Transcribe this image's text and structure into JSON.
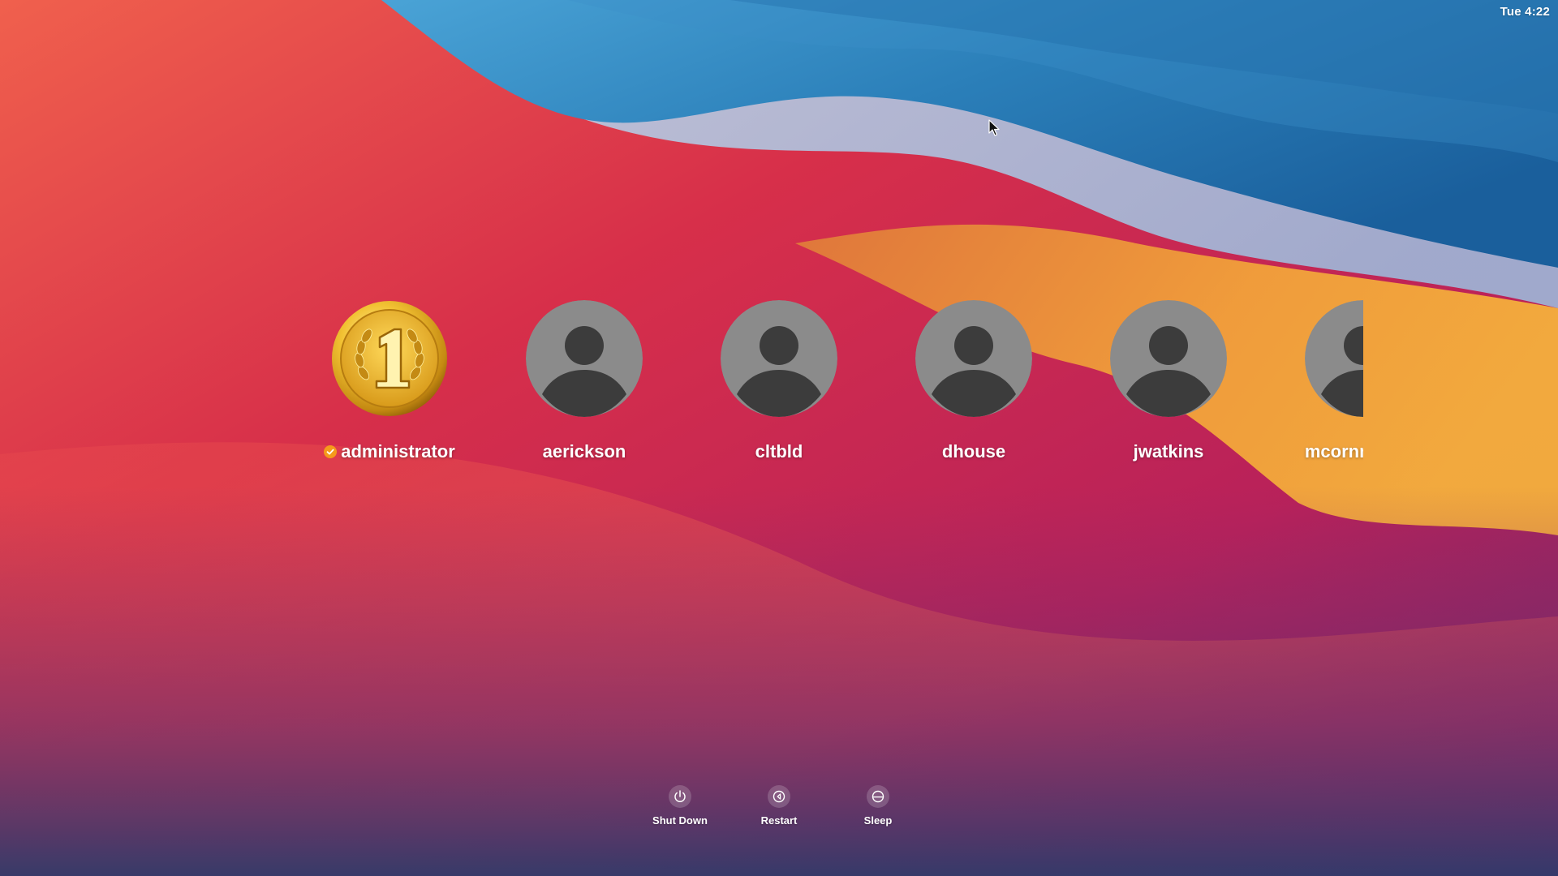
{
  "menubar": {
    "clock": "Tue 4:22"
  },
  "users": [
    {
      "name": "administrator",
      "avatar": "gold-medal-number-one",
      "badge": "checkmark-badge-icon"
    },
    {
      "name": "aerickson",
      "avatar": "generic-user-silhouette"
    },
    {
      "name": "cltbld",
      "avatar": "generic-user-silhouette"
    },
    {
      "name": "dhouse",
      "avatar": "generic-user-silhouette"
    },
    {
      "name": "jwatkins",
      "avatar": "generic-user-silhouette"
    },
    {
      "name": "mcornmesser",
      "avatar": "generic-user-silhouette"
    }
  ],
  "power": {
    "shutdown_label": "Shut Down",
    "restart_label": "Restart",
    "sleep_label": "Sleep"
  },
  "colors": {
    "badge": "#f59a1b",
    "avatar_gray": "#8b8b8b",
    "silhouette": "#3c3c3c"
  }
}
